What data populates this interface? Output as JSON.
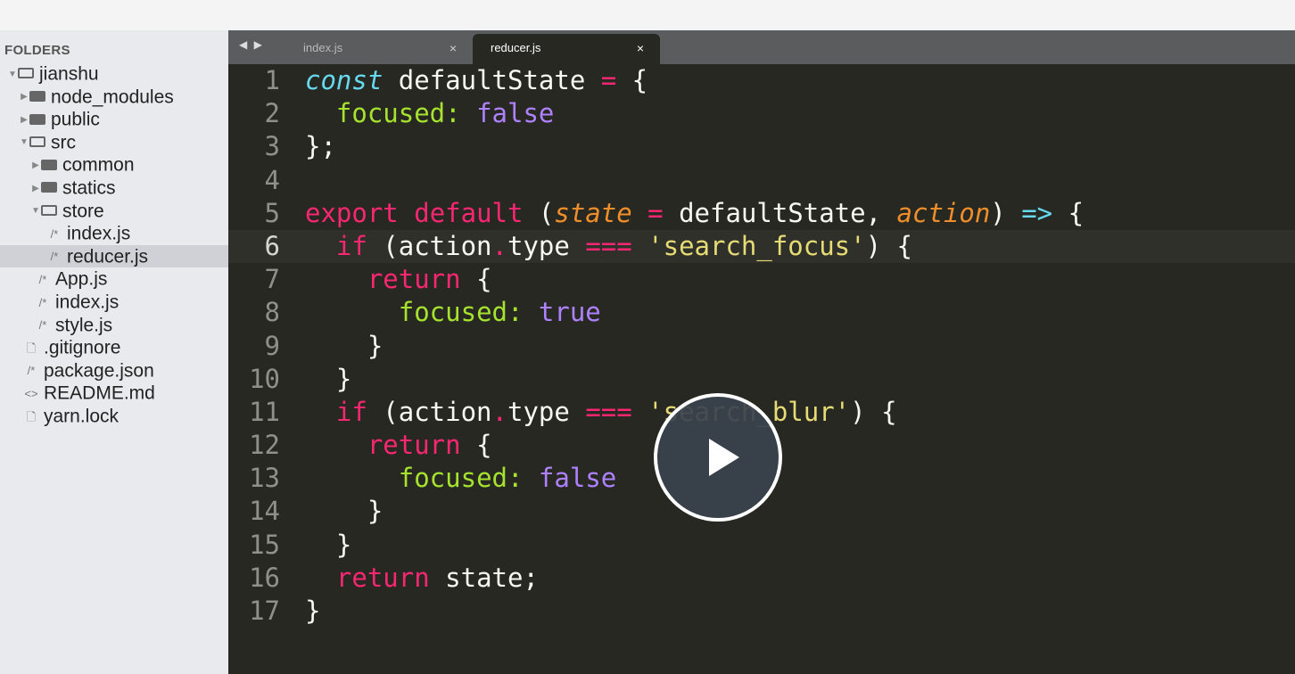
{
  "sidebar": {
    "title": "FOLDERS",
    "items": [
      {
        "label": "jianshu",
        "depth": 0,
        "kind": "folder-open",
        "arrow": "▼",
        "selected": false
      },
      {
        "label": "node_modules",
        "depth": 1,
        "kind": "folder",
        "arrow": "▶",
        "selected": false
      },
      {
        "label": "public",
        "depth": 1,
        "kind": "folder",
        "arrow": "▶",
        "selected": false
      },
      {
        "label": "src",
        "depth": 1,
        "kind": "folder-open",
        "arrow": "▼",
        "selected": false
      },
      {
        "label": "common",
        "depth": 2,
        "kind": "folder",
        "arrow": "▶",
        "selected": false
      },
      {
        "label": "statics",
        "depth": 2,
        "kind": "folder",
        "arrow": "▶",
        "selected": false
      },
      {
        "label": "store",
        "depth": 2,
        "kind": "folder-open",
        "arrow": "▼",
        "selected": false
      },
      {
        "label": "index.js",
        "depth": 3,
        "kind": "js",
        "icon": "/*",
        "selected": false
      },
      {
        "label": "reducer.js",
        "depth": 3,
        "kind": "js",
        "icon": "/*",
        "selected": true
      },
      {
        "label": "App.js",
        "depth": 2,
        "kind": "js",
        "icon": "/*",
        "selected": false
      },
      {
        "label": "index.js",
        "depth": 2,
        "kind": "js",
        "icon": "/*",
        "selected": false
      },
      {
        "label": "style.js",
        "depth": 2,
        "kind": "js",
        "icon": "/*",
        "selected": false
      },
      {
        "label": ".gitignore",
        "depth": 1,
        "kind": "file",
        "icon": "🗋",
        "selected": false
      },
      {
        "label": "package.json",
        "depth": 1,
        "kind": "js",
        "icon": "/*",
        "selected": false
      },
      {
        "label": "README.md",
        "depth": 1,
        "kind": "md",
        "icon": "<>",
        "selected": false
      },
      {
        "label": "yarn.lock",
        "depth": 1,
        "kind": "file",
        "icon": "🗋",
        "selected": false
      }
    ]
  },
  "tabs": {
    "nav": "◀ ▶",
    "close_glyph": "×",
    "items": [
      {
        "label": "index.js",
        "active": false
      },
      {
        "label": "reducer.js",
        "active": true
      }
    ]
  },
  "editor": {
    "current_line": 6,
    "lines": [
      {
        "n": "1",
        "tokens": [
          [
            "st",
            "const"
          ],
          [
            "pl",
            " defaultState "
          ],
          [
            "op",
            "="
          ],
          [
            "pl",
            " {"
          ]
        ]
      },
      {
        "n": "2",
        "tokens": [
          [
            "pl",
            "  "
          ],
          [
            "prop",
            "focused:"
          ],
          [
            "pl",
            " "
          ],
          [
            "bool",
            "false"
          ]
        ]
      },
      {
        "n": "3",
        "tokens": [
          [
            "pl",
            "};"
          ]
        ]
      },
      {
        "n": "4",
        "tokens": []
      },
      {
        "n": "5",
        "tokens": [
          [
            "kw",
            "export"
          ],
          [
            "pl",
            " "
          ],
          [
            "kw",
            "default"
          ],
          [
            "pl",
            " ("
          ],
          [
            "ar",
            "state"
          ],
          [
            "pl",
            " "
          ],
          [
            "op",
            "="
          ],
          [
            "pl",
            " defaultState, "
          ],
          [
            "ar",
            "action"
          ],
          [
            "pl",
            ") "
          ],
          [
            "arrowop",
            "=>"
          ],
          [
            "pl",
            " {"
          ]
        ]
      },
      {
        "n": "6",
        "tokens": [
          [
            "pl",
            "  "
          ],
          [
            "kw",
            "if"
          ],
          [
            "pl",
            " (action"
          ],
          [
            "op",
            "."
          ],
          [
            "pl",
            "type "
          ],
          [
            "op",
            "==="
          ],
          [
            "pl",
            " "
          ],
          [
            "str",
            "'search_focus'"
          ],
          [
            "pl",
            ") {"
          ]
        ]
      },
      {
        "n": "7",
        "tokens": [
          [
            "pl",
            "    "
          ],
          [
            "kw",
            "return"
          ],
          [
            "pl",
            " {"
          ]
        ]
      },
      {
        "n": "8",
        "tokens": [
          [
            "pl",
            "      "
          ],
          [
            "prop",
            "focused:"
          ],
          [
            "pl",
            " "
          ],
          [
            "bool",
            "true"
          ]
        ]
      },
      {
        "n": "9",
        "tokens": [
          [
            "pl",
            "    }"
          ]
        ]
      },
      {
        "n": "10",
        "tokens": [
          [
            "pl",
            "  }"
          ]
        ]
      },
      {
        "n": "11",
        "tokens": [
          [
            "pl",
            "  "
          ],
          [
            "kw",
            "if"
          ],
          [
            "pl",
            " (action"
          ],
          [
            "op",
            "."
          ],
          [
            "pl",
            "type "
          ],
          [
            "op",
            "==="
          ],
          [
            "pl",
            " "
          ],
          [
            "str",
            "'search_blur'"
          ],
          [
            "pl",
            ") {"
          ]
        ]
      },
      {
        "n": "12",
        "tokens": [
          [
            "pl",
            "    "
          ],
          [
            "kw",
            "return"
          ],
          [
            "pl",
            " {"
          ]
        ]
      },
      {
        "n": "13",
        "tokens": [
          [
            "pl",
            "      "
          ],
          [
            "prop",
            "focused:"
          ],
          [
            "pl",
            " "
          ],
          [
            "bool",
            "false"
          ]
        ]
      },
      {
        "n": "14",
        "tokens": [
          [
            "pl",
            "    }"
          ]
        ]
      },
      {
        "n": "15",
        "tokens": [
          [
            "pl",
            "  }"
          ]
        ]
      },
      {
        "n": "16",
        "tokens": [
          [
            "pl",
            "  "
          ],
          [
            "kw",
            "return"
          ],
          [
            "pl",
            " state;"
          ]
        ]
      },
      {
        "n": "17",
        "tokens": [
          [
            "pl",
            "}"
          ]
        ]
      }
    ]
  },
  "overlay": {
    "play_icon": "play-icon"
  }
}
